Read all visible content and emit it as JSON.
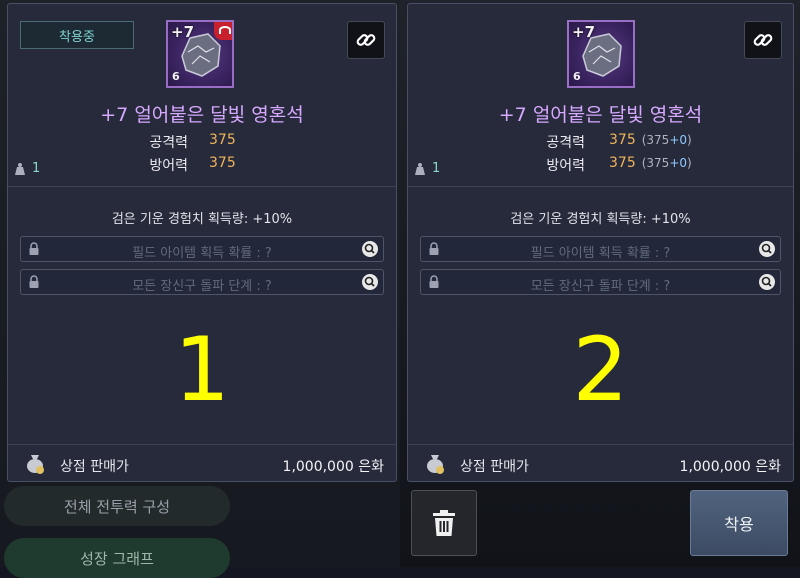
{
  "background": {
    "button1_label": "전체 전투력 구성",
    "button2_label": "성장 그래프"
  },
  "panels": [
    {
      "equip_badge": "착용중",
      "item": {
        "level_prefix": "+7",
        "level_small": "6",
        "name": "+7 얼어붙은 달빛 영혼석"
      },
      "stats": [
        {
          "label": "공격력",
          "value": "375"
        },
        {
          "label": "방어력",
          "value": "375"
        }
      ],
      "weight": "1",
      "effect": "검은 기운 경험치 획득량: +10%",
      "locked_options": [
        "필드 아이템 획득 확률 : ?",
        "모든 장신구 돌파 단계 : ?"
      ],
      "big_number": "1",
      "sell_label": "상점 판매가",
      "sell_price": "1,000,000 은화"
    },
    {
      "item": {
        "level_prefix": "+7",
        "level_small": "6",
        "name": "+7 얼어붙은 달빛 영혼석"
      },
      "stats": [
        {
          "label": "공격력",
          "value": "375",
          "base": "(375",
          "bonus": "+0",
          "close": ")"
        },
        {
          "label": "방어력",
          "value": "375",
          "base": "(375",
          "bonus": "+0",
          "close": ")"
        }
      ],
      "weight": "1",
      "effect": "검은 기운 경험치 획득량: +10%",
      "locked_options": [
        "필드 아이템 획득 확률 : ?",
        "모든 장신구 돌파 단계 : ?"
      ],
      "big_number": "2",
      "sell_label": "상점 판매가",
      "sell_price": "1,000,000 은화",
      "apply_label": "착용"
    }
  ],
  "colors": {
    "item_name": "#d7a8ff",
    "stat_value": "#f0b45a",
    "big_number": "#ffff00",
    "equip_badge_text": "#7fd2cf"
  },
  "icons": [
    "link-icon",
    "lock-icon",
    "magnify-icon",
    "weight-icon",
    "money-bag-icon",
    "trash-icon"
  ]
}
